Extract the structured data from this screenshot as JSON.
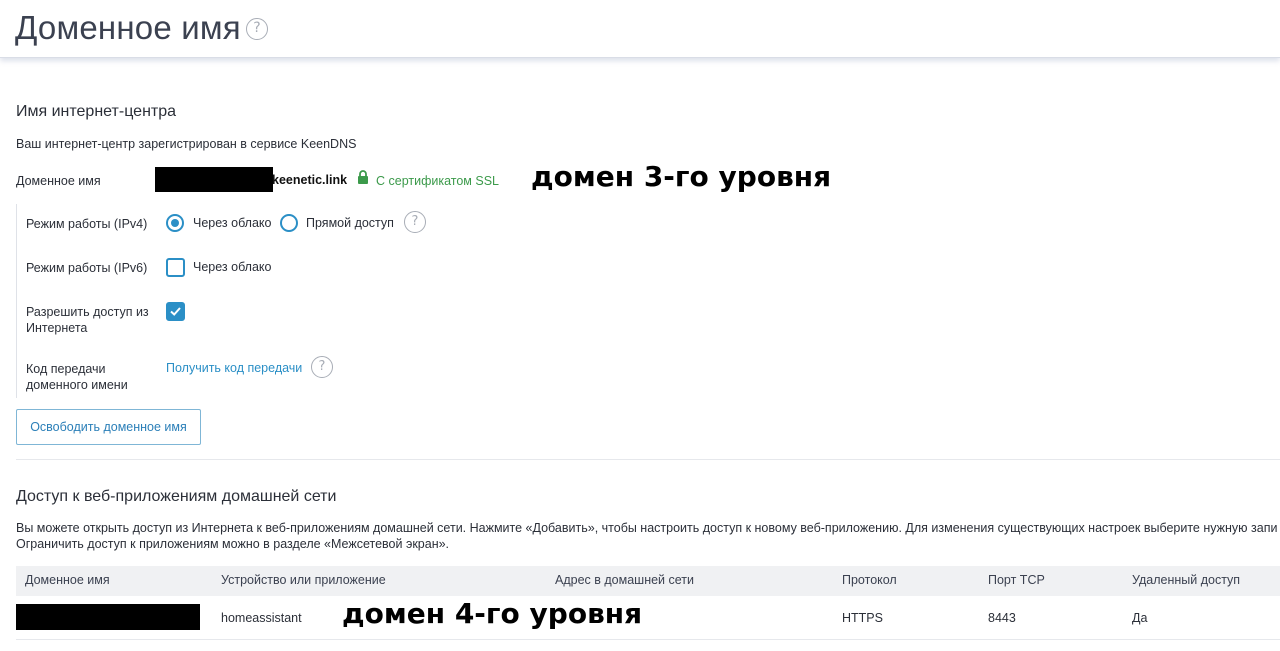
{
  "header": {
    "title": "Доменное имя"
  },
  "keendns": {
    "section_title": "Имя интернет-центра",
    "registered_text": "Ваш интернет-центр зарегистрирован в сервисе KeenDNS",
    "domain_label": "Доменное имя",
    "domain_suffix": "keenetic.link",
    "ssl_text": "С сертификатом SSL",
    "annotation": "домен 3-го уровня",
    "ipv4": {
      "label": "Режим работы (IPv4)",
      "option_cloud": "Через облако",
      "option_direct": "Прямой доступ",
      "selected": "cloud"
    },
    "ipv6": {
      "label": "Режим работы (IPv6)",
      "option_cloud": "Через облако",
      "checked": false
    },
    "internet_access": {
      "label": "Разрешить доступ из Интернета",
      "checked": true
    },
    "transfer": {
      "label": "Код передачи доменного имени",
      "link": "Получить код передачи"
    },
    "release_button": "Освободить доменное имя"
  },
  "webapps": {
    "section_title": "Доступ к веб-приложениям домашней сети",
    "description_line1": "Вы можете открыть доступ из Интернета к веб-приложениям домашней сети. Нажмите «Добавить», чтобы настроить доступ к новому веб-приложению. Для изменения существующих настроек выберите нужную запи",
    "description_line2": "Ограничить доступ к приложениям можно в разделе «Межсетевой экран».",
    "annotation": "домен 4-го уровня",
    "columns": [
      "Доменное имя",
      "Устройство или приложение",
      "Адрес в домашней сети",
      "Протокол",
      "Порт TCP",
      "Удаленный доступ"
    ],
    "rows": [
      {
        "domain": "",
        "device": "homeassistant",
        "address": "",
        "protocol": "HTTPS",
        "port": "8443",
        "remote": "Да"
      }
    ]
  },
  "colors": {
    "accent": "#2b8fc6",
    "ssl_green": "#3c9a4b",
    "title": "#3b4150"
  }
}
